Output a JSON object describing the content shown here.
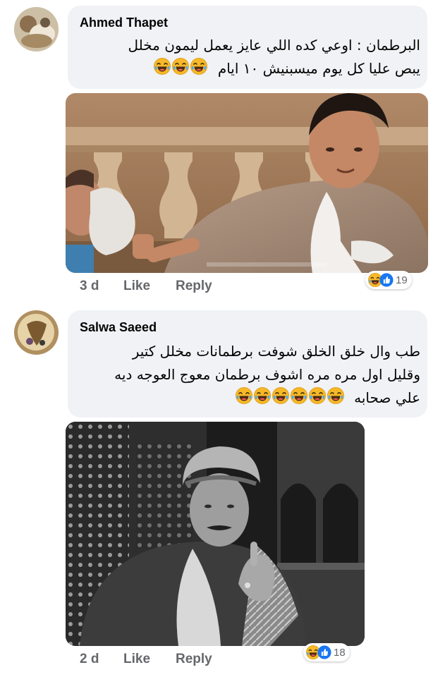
{
  "comments": [
    {
      "author": "Ahmed Thapet",
      "lines": [
        "البرطمان : اوعي كده اللي عايز يعمل ليمون مخلل",
        "يبص عليا كل يوم ميسبنيش ١٠ ايام"
      ],
      "emoji_count": 3,
      "time": "3 d",
      "like_label": "Like",
      "reply_label": "Reply",
      "reaction_count": "19",
      "reactions": [
        "haha",
        "like"
      ]
    },
    {
      "author": "Salwa Saeed",
      "lines": [
        "طب وال خلق الخلق شوفت برطمانات مخلل كتير",
        "وقليل اول مره مره اشوف برطمان معوج العوجه ديه",
        "علي صحابه"
      ],
      "emoji_count": 6,
      "time": "2 d",
      "like_label": "Like",
      "reply_label": "Reply",
      "reaction_count": "18",
      "reactions": [
        "haha",
        "like"
      ]
    }
  ],
  "colors": {
    "bubble": "#f0f2f5",
    "meta_text": "#65676b",
    "like_blue": "#1877f2",
    "haha_yellow": "#f7b928"
  },
  "icons": [
    "haha-emoji-icon",
    "like-reaction-icon"
  ]
}
